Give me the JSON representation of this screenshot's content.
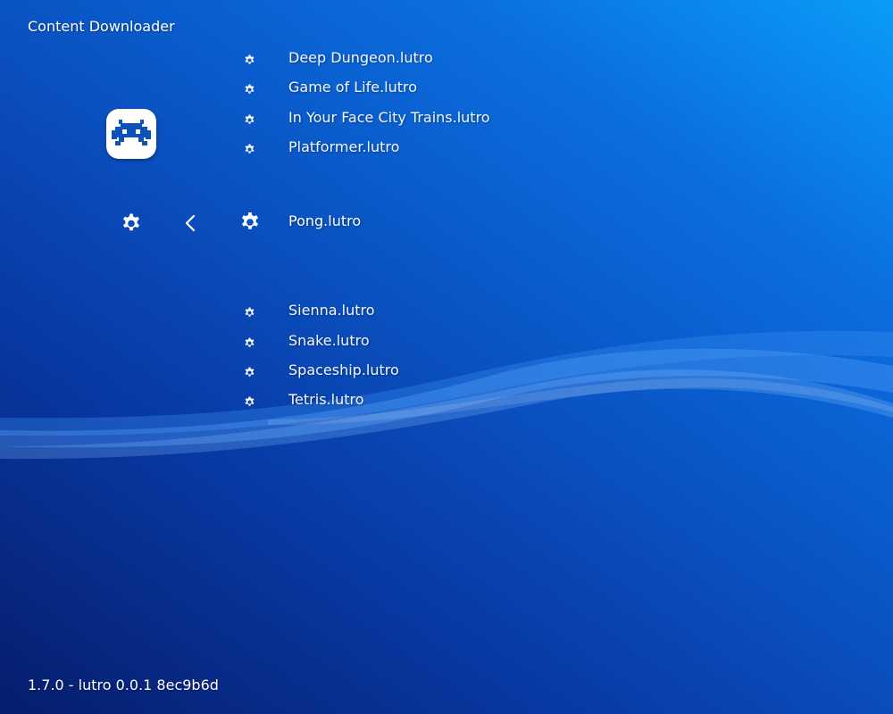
{
  "header": {
    "title": "Content Downloader"
  },
  "footer": {
    "version": "1.7.0 - lutro 0.0.1 8ec9b6d"
  },
  "logo": {
    "icon": "retroarch-invader-icon",
    "color": "#0c52b8"
  },
  "tabs": {
    "settings_icon": "gear-icon",
    "back_icon": "chevron-left-icon"
  },
  "list": {
    "items": [
      {
        "label": "Deep Dungeon.lutro",
        "icon": "gear-icon",
        "selected": false
      },
      {
        "label": "Game of Life.lutro",
        "icon": "gear-icon",
        "selected": false
      },
      {
        "label": "In Your Face City Trains.lutro",
        "icon": "gear-icon",
        "selected": false
      },
      {
        "label": "Platformer.lutro",
        "icon": "gear-icon",
        "selected": false
      },
      {
        "label": "Pong.lutro",
        "icon": "gear-icon",
        "selected": true
      },
      {
        "label": "Sienna.lutro",
        "icon": "gear-icon",
        "selected": false
      },
      {
        "label": "Snake.lutro",
        "icon": "gear-icon",
        "selected": false
      },
      {
        "label": "Spaceship.lutro",
        "icon": "gear-icon",
        "selected": false
      },
      {
        "label": "Tetris.lutro",
        "icon": "gear-icon",
        "selected": false
      }
    ]
  }
}
